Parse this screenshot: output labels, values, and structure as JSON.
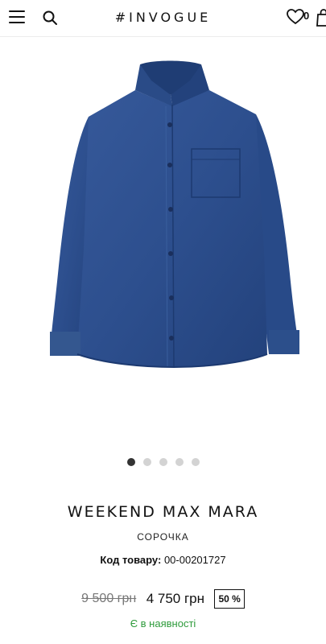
{
  "header": {
    "logo": "#INVOGUE",
    "wishlist_count": "0"
  },
  "gallery": {
    "total": 5,
    "active_index": 0
  },
  "product": {
    "brand": "WEEKEND MAX MARA",
    "category": "СОРОЧКА",
    "sku_label": "Код товару:",
    "sku_value": "00-00201727",
    "old_price": "9 500 грн",
    "new_price": "4 750 грн",
    "discount": "50 %",
    "stock": "Є в наявності"
  },
  "colors": {
    "denim": "#2d4f8e",
    "in_stock": "#2e9b3b"
  }
}
